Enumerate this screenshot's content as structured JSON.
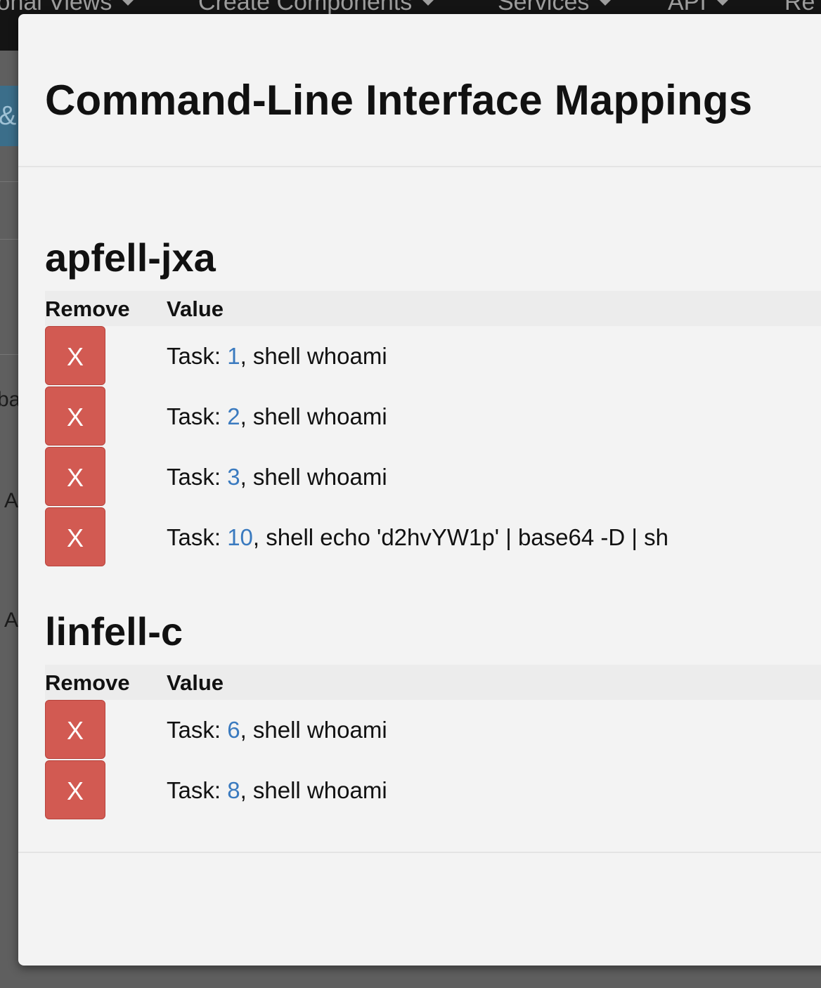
{
  "background": {
    "nav_items": [
      {
        "label": "ional Views"
      },
      {
        "label": "Create Components"
      },
      {
        "label": "Services"
      },
      {
        "label": "API"
      },
      {
        "label": "Re"
      }
    ],
    "chip_text": "&",
    "fragments": [
      "ba",
      "A",
      "A"
    ]
  },
  "modal": {
    "title": "Command-Line Interface Mappings",
    "sections": [
      {
        "name": "apfell-jxa",
        "columns": {
          "remove": "Remove",
          "value": "Value"
        },
        "rows": [
          {
            "button": "X",
            "prefix": "Task: ",
            "task_id": "1",
            "command": ", shell whoami"
          },
          {
            "button": "X",
            "prefix": "Task: ",
            "task_id": "2",
            "command": ", shell whoami"
          },
          {
            "button": "X",
            "prefix": "Task: ",
            "task_id": "3",
            "command": ", shell whoami"
          },
          {
            "button": "X",
            "prefix": "Task: ",
            "task_id": "10",
            "command": ", shell echo 'd2hvYW1p' | base64 -D | sh"
          }
        ]
      },
      {
        "name": "linfell-c",
        "columns": {
          "remove": "Remove",
          "value": "Value"
        },
        "rows": [
          {
            "button": "X",
            "prefix": "Task: ",
            "task_id": "6",
            "command": ", shell whoami"
          },
          {
            "button": "X",
            "prefix": "Task: ",
            "task_id": "8",
            "command": ", shell whoami"
          }
        ]
      }
    ]
  },
  "colors": {
    "remove_button": "#d25a52",
    "task_link": "#3a7abf",
    "navbar": "#141414"
  }
}
